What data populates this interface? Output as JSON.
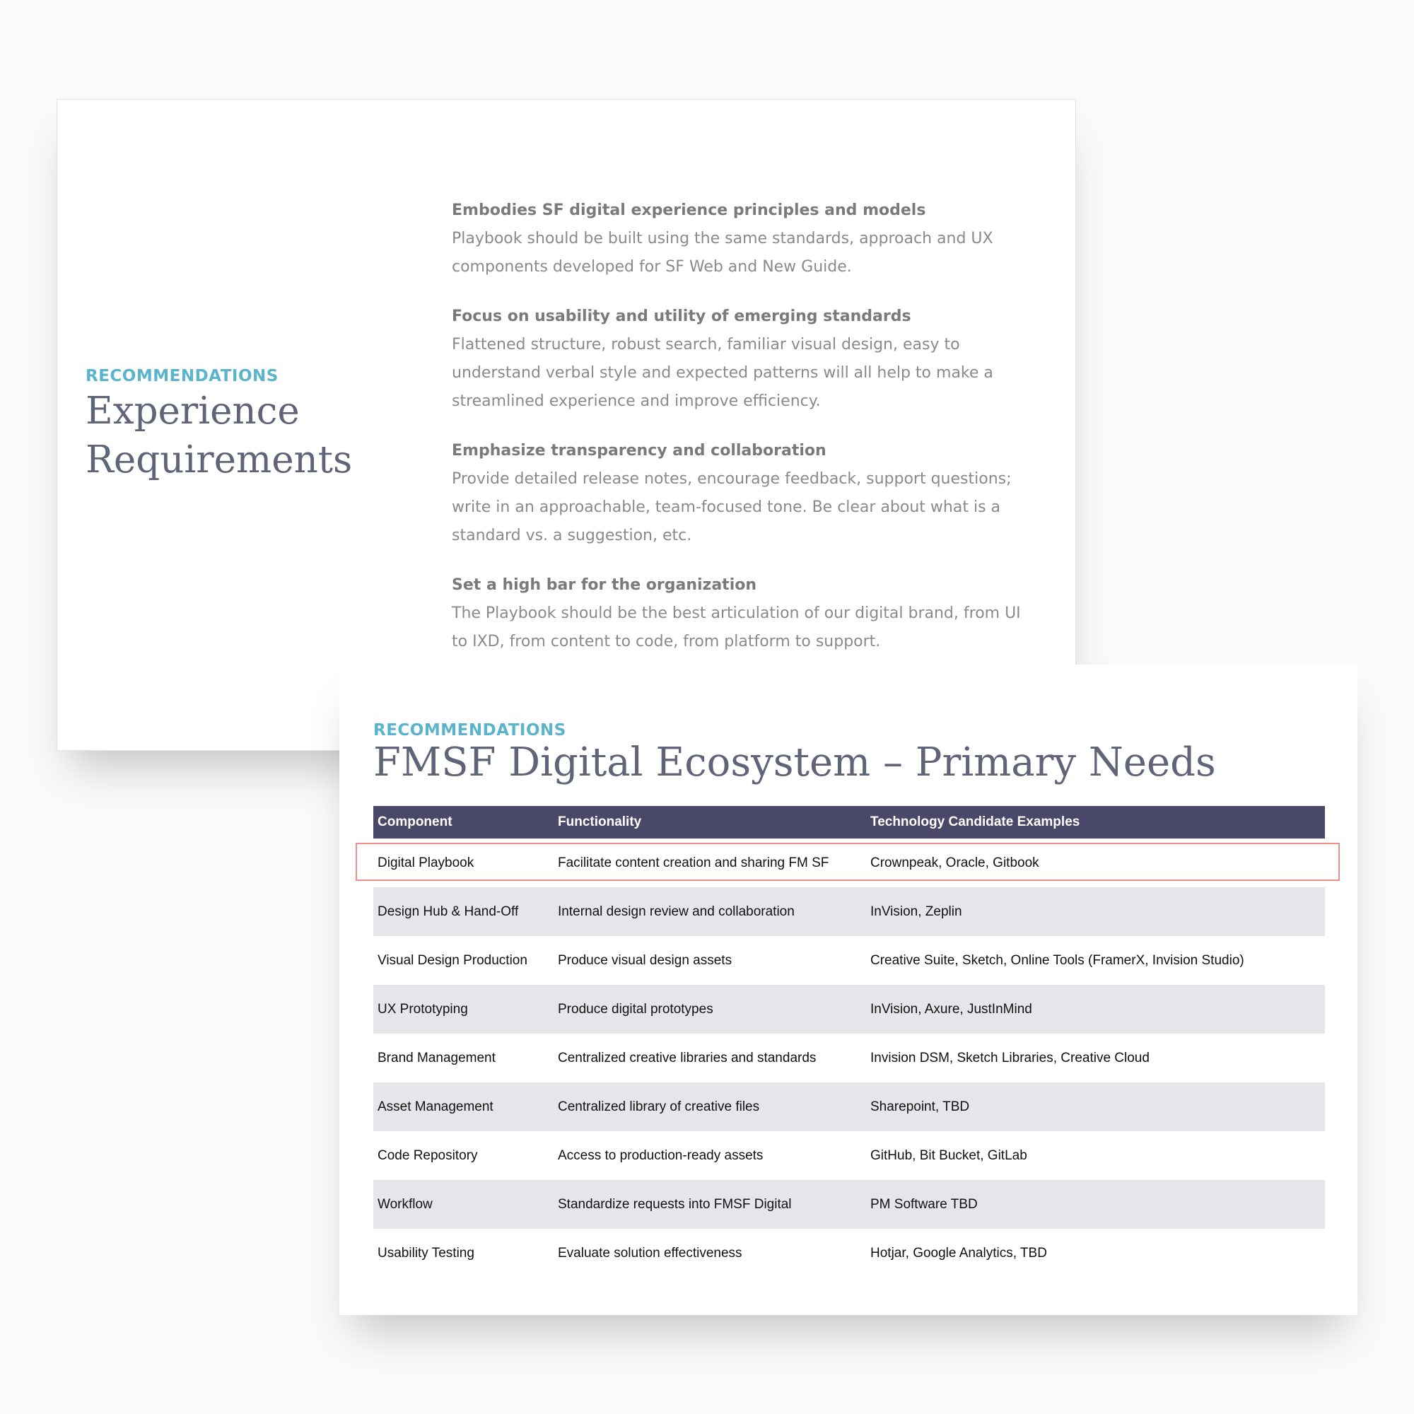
{
  "slide1": {
    "kicker": "RECOMMENDATIONS",
    "title": "Experience Requirements",
    "principles": [
      {
        "heading": "Embodies SF digital experience principles and models",
        "text": "Playbook should be built using the same standards, approach and UX components developed for SF Web and New Guide."
      },
      {
        "heading": "Focus on usability and utility of emerging standards",
        "text": "Flattened structure, robust search, familiar visual design, easy to understand verbal style and expected patterns will all help to make a streamlined experience and improve efficiency."
      },
      {
        "heading": "Emphasize transparency and collaboration",
        "text": "Provide detailed release notes, encourage feedback, support questions; write in an approachable, team-focused tone. Be clear about what is a standard vs. a suggestion, etc."
      },
      {
        "heading": "Set a high bar for the organization",
        "text": "The Playbook should be the best articulation of our digital brand, from UI to IXD, from content to code, from platform to support."
      }
    ]
  },
  "slide2": {
    "kicker": "RECOMMENDATIONS",
    "title": "FMSF Digital Ecosystem – Primary Needs",
    "table": {
      "headers": [
        "Component",
        "Functionality",
        "Technology Candidate Examples"
      ],
      "rows": [
        [
          "Digital Playbook",
          "Facilitate content creation and sharing FM SF",
          "Crownpeak, Oracle, Gitbook"
        ],
        [
          "Design Hub & Hand-Off",
          "Internal design review and collaboration",
          "InVision, Zeplin"
        ],
        [
          "Visual Design Production",
          "Produce visual design assets",
          "Creative Suite, Sketch, Online Tools (FramerX, Invision Studio)"
        ],
        [
          "UX Prototyping",
          "Produce digital prototypes",
          "InVision, Axure, JustInMind"
        ],
        [
          "Brand Management",
          "Centralized creative libraries and standards",
          "Invision DSM, Sketch Libraries, Creative Cloud"
        ],
        [
          "Asset Management",
          "Centralized library of creative files",
          "Sharepoint, TBD"
        ],
        [
          "Code Repository",
          "Access to production-ready assets",
          "GitHub, Bit Bucket, GitLab"
        ],
        [
          "Workflow",
          "Standardize requests into FMSF Digital",
          "PM Software TBD"
        ],
        [
          "Usability Testing",
          "Evaluate solution effectiveness",
          "Hotjar, Google Analytics, TBD"
        ]
      ]
    }
  },
  "colors": {
    "accent": "#5ab4cb",
    "title": "#5f6478",
    "table_header": "#494868",
    "row_shade": "#e6e6ea",
    "highlight": "#ee8f8f"
  }
}
